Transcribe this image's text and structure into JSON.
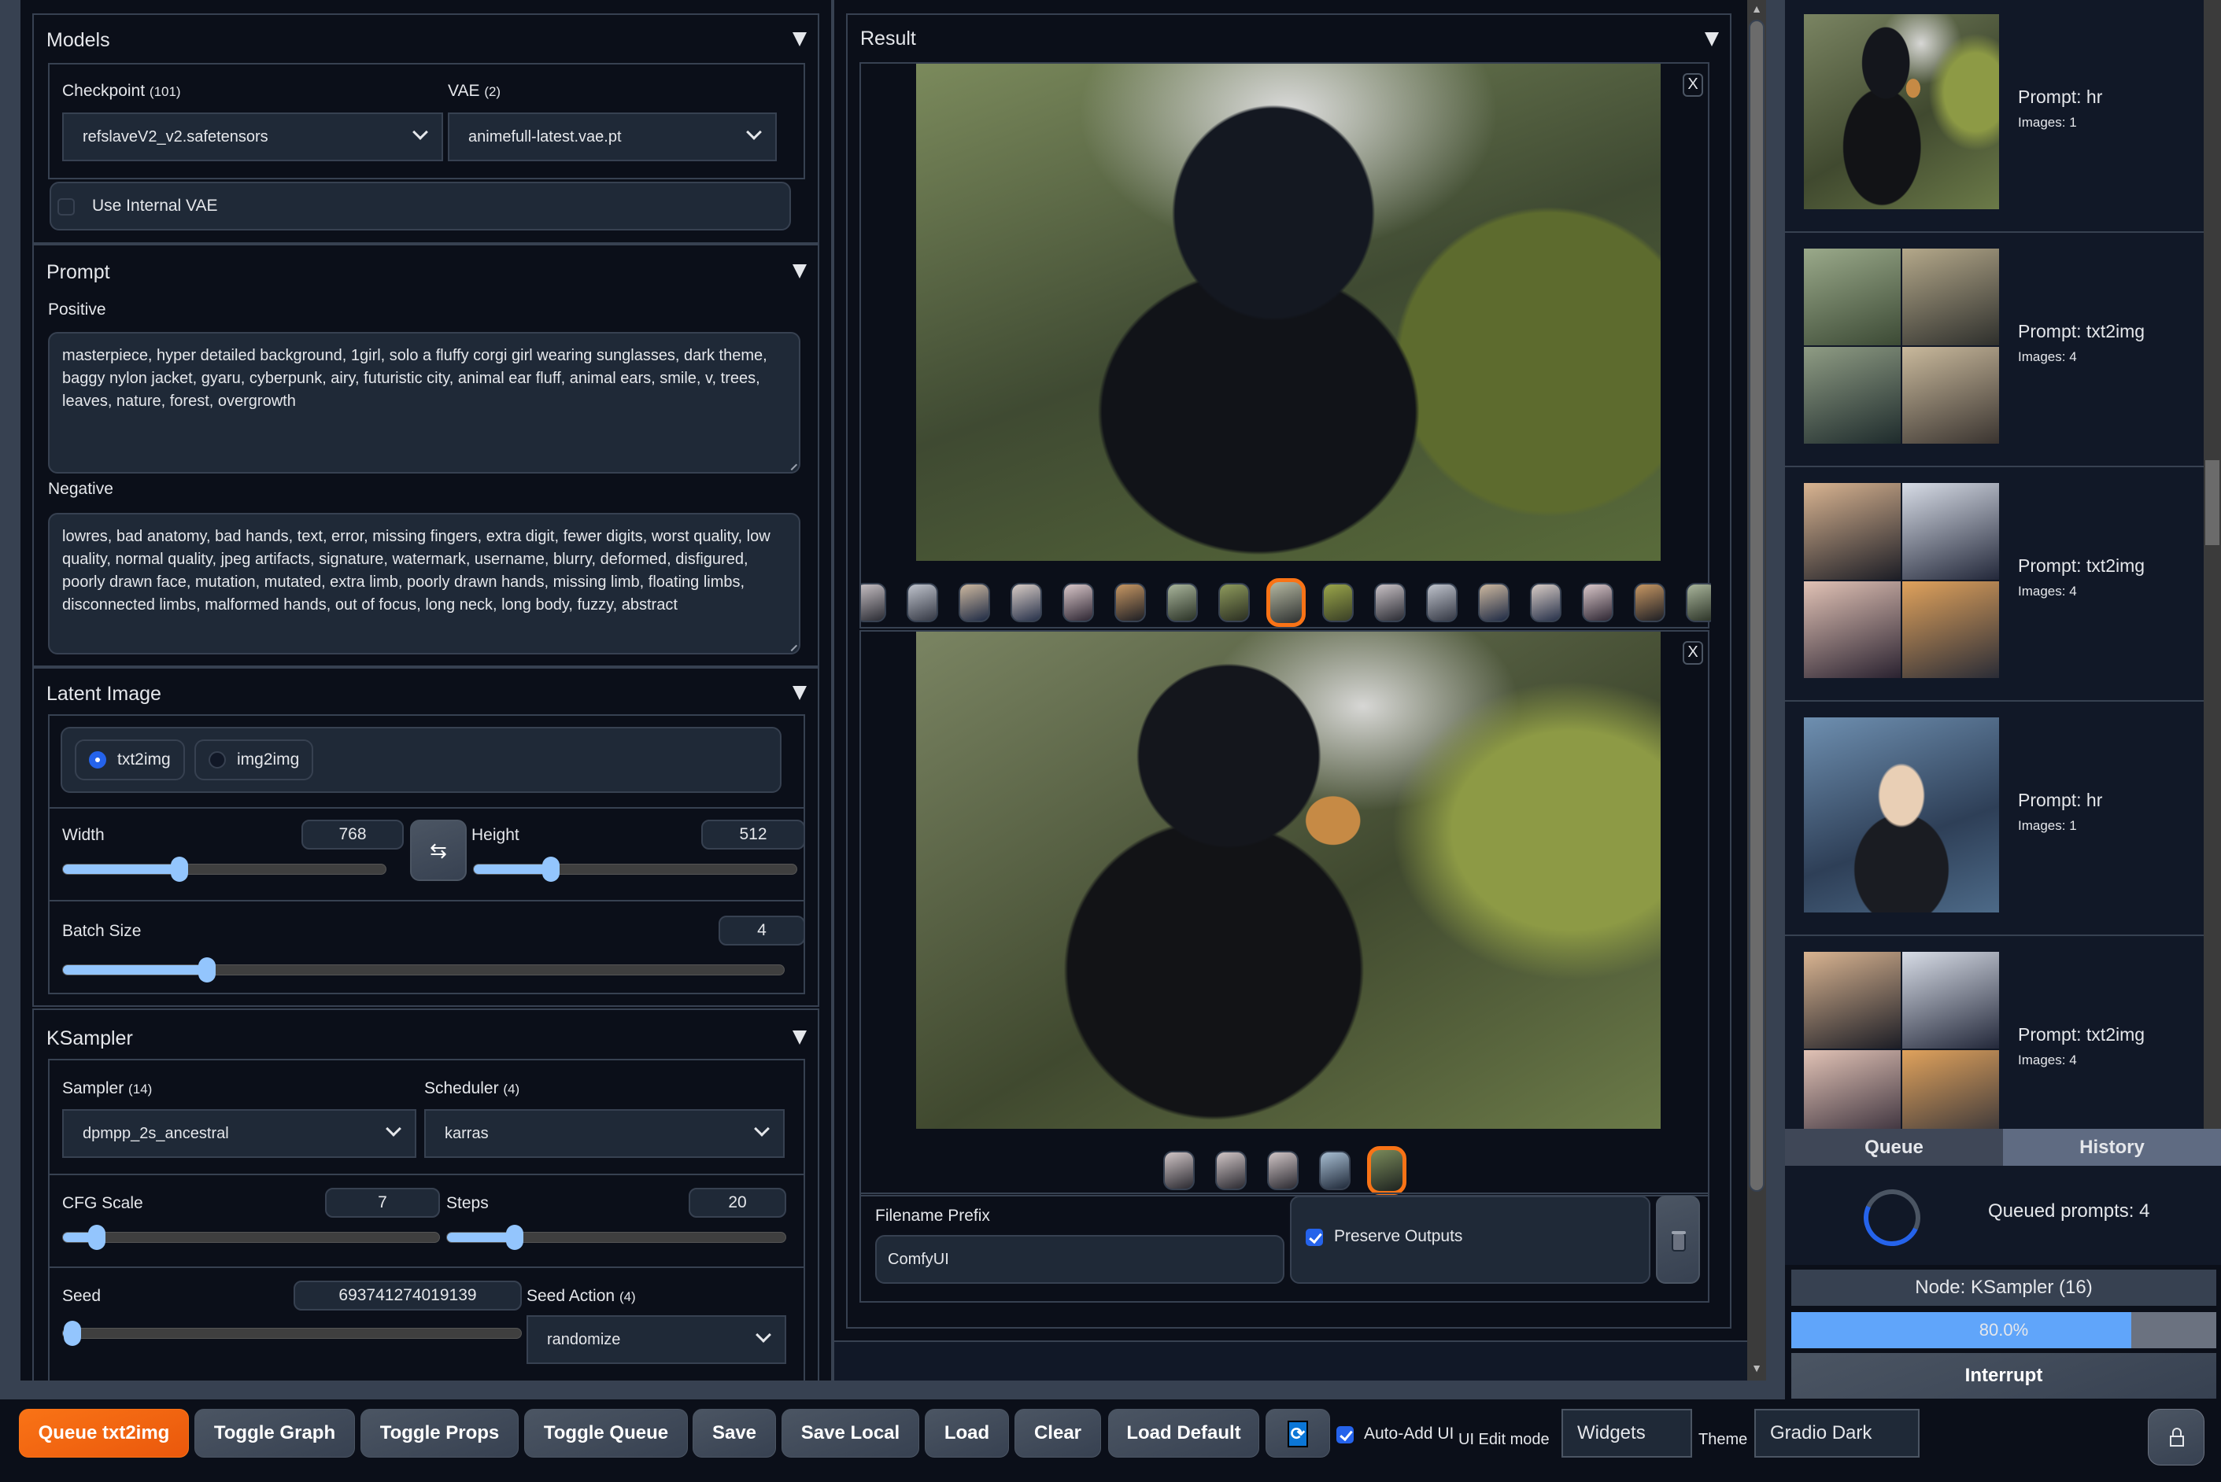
{
  "models": {
    "title": "Models",
    "checkpoint_label": "Checkpoint",
    "checkpoint_count": "(101)",
    "checkpoint_value": "refslaveV2_v2.safetensors",
    "vae_label": "VAE",
    "vae_count": "(2)",
    "vae_value": "animefull-latest.vae.pt",
    "use_internal_vae_label": "Use Internal VAE",
    "use_internal_vae_checked": false
  },
  "prompt": {
    "title": "Prompt",
    "positive_label": "Positive",
    "positive_value": "masterpiece, hyper detailed background, 1girl, solo a fluffy corgi girl wearing sunglasses, dark theme, baggy nylon jacket, gyaru, cyberpunk, airy, futuristic city, animal ear fluff, animal ears, smile, v, trees, leaves, nature, forest, overgrowth",
    "negative_label": "Negative",
    "negative_value": "lowres, bad anatomy, bad hands, text, error, missing fingers, extra digit, fewer digits, worst quality, low quality, normal quality, jpeg artifacts, signature, watermark, username, blurry, deformed, disfigured, poorly drawn face, mutation, mutated, extra limb, poorly drawn hands, missing limb, floating limbs, disconnected limbs, malformed hands, out of focus, long neck, long body, fuzzy, abstract"
  },
  "latent": {
    "title": "Latent Image",
    "modes": [
      {
        "label": "txt2img",
        "selected": true
      },
      {
        "label": "img2img",
        "selected": false
      }
    ],
    "width_label": "Width",
    "width_value": "768",
    "width_fraction": 0.36,
    "swap_icon": "⇆",
    "height_label": "Height",
    "height_value": "512",
    "height_fraction": 0.24,
    "batch_label": "Batch Size",
    "batch_value": "4",
    "batch_fraction": 0.2
  },
  "ksampler": {
    "title": "KSampler",
    "sampler_label": "Sampler",
    "sampler_count": "(14)",
    "sampler_value": "dpmpp_2s_ancestral",
    "scheduler_label": "Scheduler",
    "scheduler_count": "(4)",
    "scheduler_value": "karras",
    "cfg_label": "CFG Scale",
    "cfg_value": "7",
    "cfg_fraction": 0.09,
    "steps_label": "Steps",
    "steps_value": "20",
    "steps_fraction": 0.2,
    "seed_label": "Seed",
    "seed_value": "693741274019139",
    "seed_fraction": 0.02,
    "seed_action_label": "Seed Action",
    "seed_action_count": "(4)",
    "seed_action_value": "randomize"
  },
  "result": {
    "title": "Result",
    "close_label": "X",
    "thumb_strip_count": 17,
    "thumb_strip_selected": 8,
    "second_thumb_count": 5,
    "second_thumb_selected": 4,
    "filename_prefix_label": "Filename Prefix",
    "filename_prefix_value": "ComfyUI",
    "preserve_outputs_label": "Preserve Outputs",
    "preserve_outputs_checked": true
  },
  "history": {
    "items": [
      {
        "prompt": "Prompt: hr",
        "images": "Images: 1",
        "kind": "single-forest"
      },
      {
        "prompt": "Prompt: txt2img",
        "images": "Images: 4",
        "kind": "grid-forest"
      },
      {
        "prompt": "Prompt: txt2img",
        "images": "Images: 4",
        "kind": "grid-city"
      },
      {
        "prompt": "Prompt: hr",
        "images": "Images: 1",
        "kind": "single-city"
      },
      {
        "prompt": "Prompt: txt2img",
        "images": "Images: 4",
        "kind": "grid-city"
      }
    ]
  },
  "queue": {
    "tab_queue": "Queue",
    "tab_history": "History",
    "active_tab": "History",
    "queued_text": "Queued prompts: 4",
    "node_text": "Node: KSampler (16)",
    "progress_percent": 80.0,
    "progress_text": "80.0%",
    "interrupt_label": "Interrupt"
  },
  "toolbar": {
    "queue_label": "Queue txt2img",
    "toggle_graph": "Toggle Graph",
    "toggle_props": "Toggle Props",
    "toggle_queue": "Toggle Queue",
    "save": "Save",
    "save_local": "Save Local",
    "load": "Load",
    "clear": "Clear",
    "load_default": "Load Default",
    "refresh_icon": "⟳",
    "auto_add_label": "Auto-Add UI",
    "auto_add_checked": true,
    "ui_edit_mode_label": "UI Edit mode",
    "ui_edit_mode_value": "Widgets",
    "theme_label": "Theme",
    "theme_value": "Gradio Dark"
  },
  "colors": {
    "accent_orange": "#f97316",
    "accent_blue": "#2563eb",
    "slider_blue": "#93c5fd",
    "progress_blue": "#60a5fa",
    "background": "#0b0f19",
    "panel": "#1f2937"
  }
}
